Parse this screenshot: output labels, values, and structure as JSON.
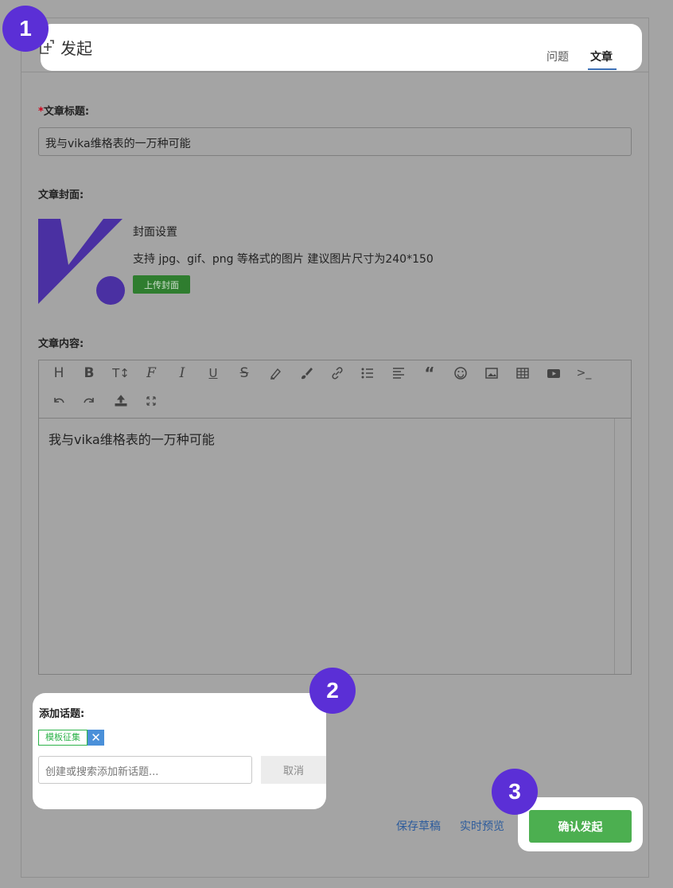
{
  "header": {
    "title": "发起",
    "tabs": [
      {
        "label": "问题"
      },
      {
        "label": "文章"
      }
    ],
    "active_tab": "文章"
  },
  "form": {
    "title_label_required": "*",
    "title_label": "文章标题:",
    "title_value": "我与vika维格表的一万种可能",
    "cover_label": "文章封面:",
    "cover_heading": "封面设置",
    "cover_hint": "支持 jpg、gif、png 等格式的图片 建议图片尺寸为240*150",
    "upload_label": "上传封面",
    "content_label": "文章内容:",
    "content_value": "我与vika维格表的一万种可能"
  },
  "topics": {
    "label": "添加话题:",
    "tags": [
      {
        "label": "模板征集"
      }
    ],
    "input_placeholder": "创建或搜索添加新话题...",
    "cancel_label": "取消"
  },
  "actions": {
    "save_draft": "保存草稿",
    "preview": "实时预览",
    "confirm": "确认发起"
  },
  "badges": [
    "1",
    "2",
    "3"
  ],
  "colors": {
    "confirm": "#4caf50",
    "upload": "#2f7d2f",
    "badge": "#5b2fd6",
    "tag": "#2db34a"
  }
}
